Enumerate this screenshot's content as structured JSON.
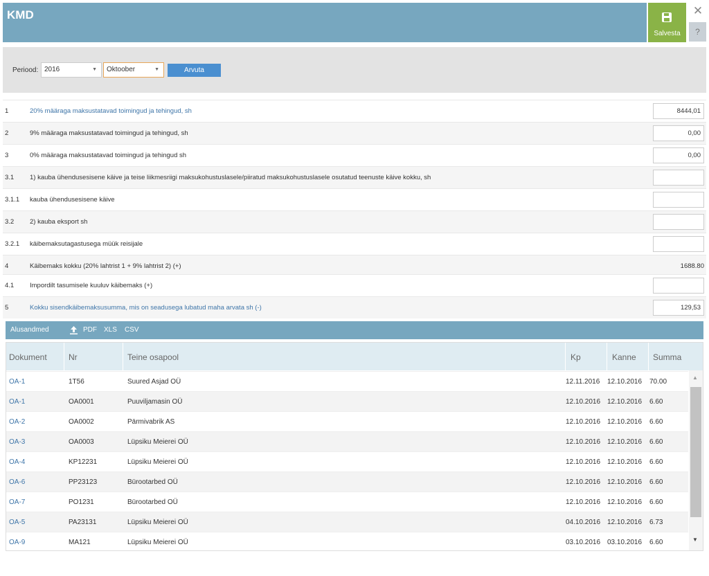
{
  "header": {
    "title": "KMD",
    "save_label": "Salvesta",
    "close_symbol": "✕",
    "help_symbol": "?"
  },
  "filter": {
    "period_label": "Periood:",
    "year": "2016",
    "month": "Oktoober",
    "calculate_label": "Arvuta"
  },
  "form_rows": [
    {
      "num": "1",
      "label": "20% määraga maksustatavad toimingud ja tehingud, sh",
      "value": "8444,01"
    },
    {
      "num": "2",
      "label": "9% määraga maksustatavad toimingud ja tehingud, sh",
      "value": "0,00"
    },
    {
      "num": "3",
      "label": "0% määraga maksustatavad toimingud ja tehingud sh",
      "value": "0,00"
    },
    {
      "num": "3.1",
      "label": "1) kauba ühendusesisene käive ja teise liikmesriigi maksukohustuslasele/piiratud maksukohustuslasele osutatud teenuste käive kokku, sh",
      "value": ""
    },
    {
      "num": "3.1.1",
      "label": "kauba ühendusesisene käive",
      "value": ""
    },
    {
      "num": "3.2",
      "label": "2) kauba eksport sh",
      "value": ""
    },
    {
      "num": "3.2.1",
      "label": "käibemaksutagastusega müük reisijale",
      "value": ""
    },
    {
      "num": "4",
      "label": "Käibemaks kokku (20% lahtrist 1 + 9% lahtrist 2) (+)",
      "value": "1688.80"
    },
    {
      "num": "4.1",
      "label": "Impordilt tasumisele kuuluv käibemaks (+)",
      "value": ""
    },
    {
      "num": "5",
      "label": "Kokku sisendkäibemaksusumma, mis on seadusega lubatud maha arvata sh (-)",
      "value": "129,53"
    }
  ],
  "section": {
    "title": "Alusandmed",
    "export_icon": "upload-icon",
    "exports": [
      "PDF",
      "XLS",
      "CSV"
    ]
  },
  "table": {
    "columns": [
      "Dokument",
      "Nr",
      "Teine osapool",
      "Kp",
      "Kanne",
      "Summa"
    ],
    "rows": [
      [
        "OA-1",
        "1T56",
        "Suured Asjad OÜ",
        "12.11.2016",
        "12.10.2016",
        "70.00"
      ],
      [
        "OA-1",
        "OA0001",
        "Puuviljamasin OÜ",
        "12.10.2016",
        "12.10.2016",
        "6.60"
      ],
      [
        "OA-2",
        "OA0002",
        "Pärmivabrik AS",
        "12.10.2016",
        "12.10.2016",
        "6.60"
      ],
      [
        "OA-3",
        "OA0003",
        "Lüpsiku Meierei OÜ",
        "12.10.2016",
        "12.10.2016",
        "6.60"
      ],
      [
        "OA-4",
        "KP12231",
        "Lüpsiku Meierei OÜ",
        "12.10.2016",
        "12.10.2016",
        "6.60"
      ],
      [
        "OA-6",
        "PP23123",
        "Bürootarbed OÜ",
        "12.10.2016",
        "12.10.2016",
        "6.60"
      ],
      [
        "OA-7",
        "PO1231",
        "Bürootarbed OÜ",
        "12.10.2016",
        "12.10.2016",
        "6.60"
      ],
      [
        "OA-5",
        "PA23131",
        "Lüpsiku Meierei OÜ",
        "04.10.2016",
        "12.10.2016",
        "6.73"
      ],
      [
        "OA-9",
        "MA121",
        "Lüpsiku Meierei OÜ",
        "03.10.2016",
        "03.10.2016",
        "6.60"
      ]
    ]
  },
  "colors": {
    "header_bg": "#77a7bf",
    "save_bg": "#8ab347",
    "button_blue": "#4a8fd0",
    "link": "#3e75a8"
  }
}
